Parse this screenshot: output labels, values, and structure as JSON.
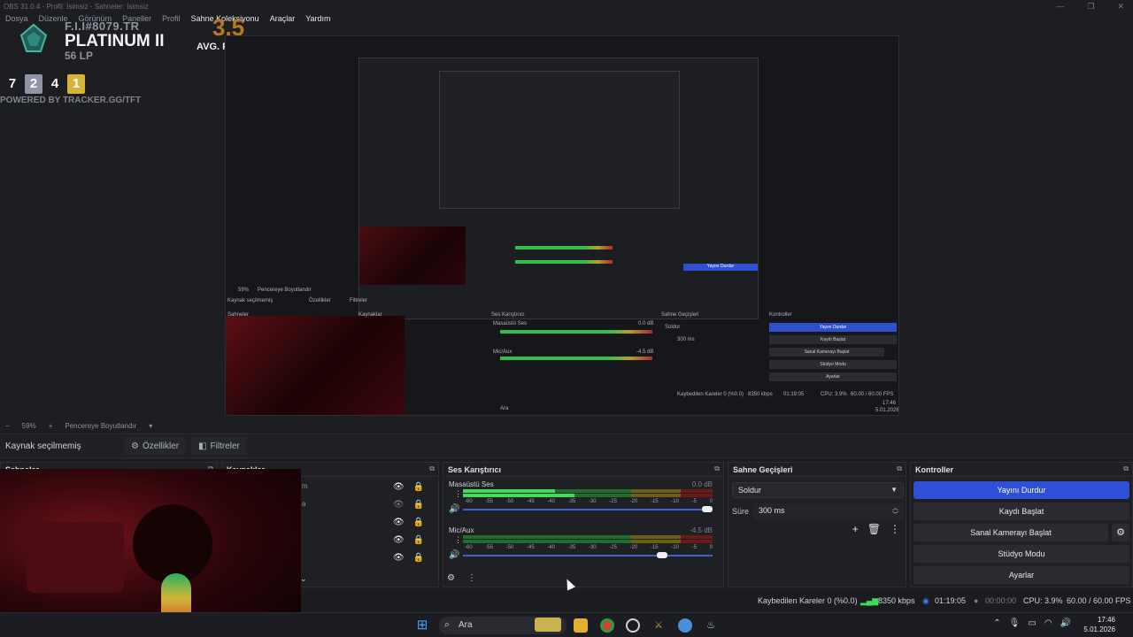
{
  "window": {
    "title": "OBS 31.0.4 - Profil: İsimsiz - Sahneler: İsimsiz",
    "controls": [
      "—",
      "❐",
      "✕"
    ]
  },
  "menu": [
    "Dosya",
    "Düzenle",
    "Görünüm",
    "Paneller",
    "Profil",
    "Sahne Koleksiyonu",
    "Araçlar",
    "Yardım"
  ],
  "overlay": {
    "user": "F.I.I#8079.TR",
    "rank": "PLATINUM II",
    "lp": "56 LP",
    "avg": "3.5",
    "avg_label": "AVG. PLACE",
    "places": [
      "7",
      "2",
      "4",
      "1"
    ],
    "powered": "POWERED BY TRACKER.GG/TFT"
  },
  "preview": {
    "inner_labels": [
      "Kaynak seçilmemiş",
      "Özellikler",
      "Filtreler",
      "Ses Karıştırıcı",
      "Sahne Geçişleri",
      "Kontroller",
      "Yayını Durdur",
      "Kaydı Başlat",
      "Sanal Kamerayı Başlat",
      "Stüdyo Modu",
      "Ayarlar",
      "Soldur",
      "300 ms",
      "Kaybedilen Kareler 0 (%0.0)",
      "8350 kbps",
      "01:19:05",
      "CPU: 3.9%",
      "60.00 / 60.00 FPS",
      "Masaüstü Ses",
      "Mic/Aux",
      "0.0 dB",
      "-4.5 dB",
      "Ara",
      "59%",
      "Pencereye Boyutlandır",
      "Sahneler",
      "Kaynaklar",
      "17:46",
      "5.01.2026"
    ]
  },
  "zoom": {
    "minus": "−",
    "value": "59%",
    "plus": "+",
    "fit": "Pencereye Boyutlandır",
    "chevron": "▾"
  },
  "sourcebar": {
    "label": "Kaynak seçilmemiş",
    "properties": "Özellikler",
    "filters": "Filtreler"
  },
  "docks": {
    "scenes": {
      "title": "Sahneler"
    },
    "sources": {
      "title": "Kaynaklar",
      "partial": [
        "m",
        "a"
      ]
    },
    "mixer": {
      "title": "Ses Karıştırıcı",
      "channels": [
        {
          "name": "Masaüstü Ses",
          "db": "0.0 dB",
          "volume": 1.0
        },
        {
          "name": "Mic/Aux",
          "db": "-4.5 dB",
          "volume": 0.82
        }
      ],
      "scale": [
        "-60",
        "-55",
        "-50",
        "-45",
        "-40",
        "-35",
        "-30",
        "-25",
        "-20",
        "-15",
        "-10",
        "-5",
        "0"
      ]
    },
    "transitions": {
      "title": "Sahne Geçişleri",
      "type": "Soldur",
      "duration_label": "Süre",
      "duration": "300 ms"
    },
    "controls": {
      "title": "Kontroller",
      "buttons": [
        "Yayını Durdur",
        "Kaydı Başlat",
        "Sanal Kamerayı Başlat",
        "Stüdyo Modu",
        "Ayarlar"
      ]
    }
  },
  "status": {
    "dropped": "Kaybedilen Kareler 0 (%0.0)",
    "bitrate": "8350 kbps",
    "stream_time": "01:19:05",
    "rec_time": "00:00:00",
    "cpu": "CPU: 3.9%",
    "fps": "60.00 / 60.00 FPS"
  },
  "taskbar": {
    "search": "Ara",
    "time": "17:46",
    "date": "5.01.2026"
  },
  "colors": {
    "accent": "#2f4fd6",
    "meter_green": "#2fbf4a",
    "meter_yellow": "#b3a22a",
    "meter_red": "#b02a2a",
    "rank_orange": "#b8791c"
  }
}
